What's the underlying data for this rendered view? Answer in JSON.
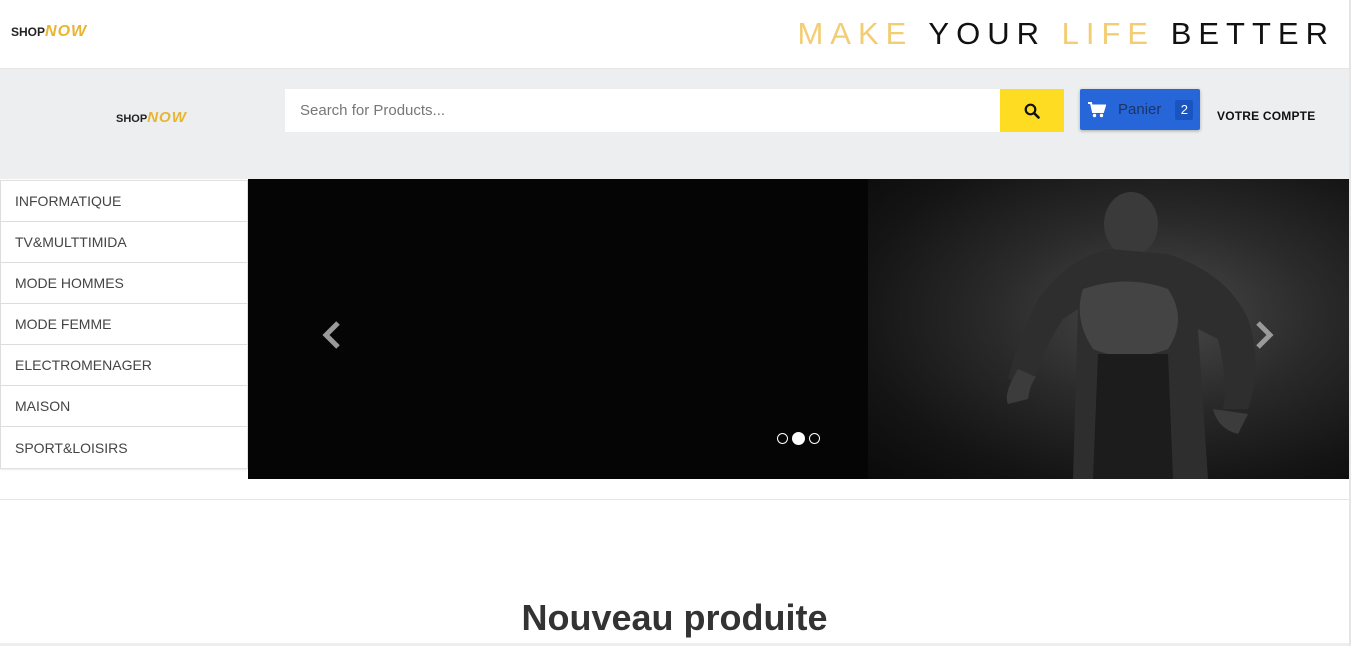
{
  "brand": {
    "logo_shop": "SHOP",
    "logo_now": "NOW",
    "accent_gold": "#f3cd74",
    "accent_yellow": "#fedc21",
    "accent_blue": "#2766d8"
  },
  "slogan": {
    "w1": "MAKE",
    "w2": "YOUR",
    "w3": "LIFE",
    "w4": "BETTER"
  },
  "search": {
    "placeholder": "Search for Products...",
    "icon": "search-icon"
  },
  "cart": {
    "label": "Panier",
    "count": "2",
    "icon": "cart-icon"
  },
  "account": {
    "label": "VOTRE COMPTE"
  },
  "categories": [
    "INFORMATIQUE",
    "TV&MULTTIMIDA",
    "MODE HOMMES",
    "MODE FEMME",
    "ELECTROMENAGER",
    "MAISON",
    "SPORT&LOISIRS"
  ],
  "carousel": {
    "slides": 3,
    "active_slide": 2,
    "prev_icon": "chevron-left-icon",
    "next_icon": "chevron-right-icon"
  },
  "section": {
    "title": "Nouveau produite"
  }
}
